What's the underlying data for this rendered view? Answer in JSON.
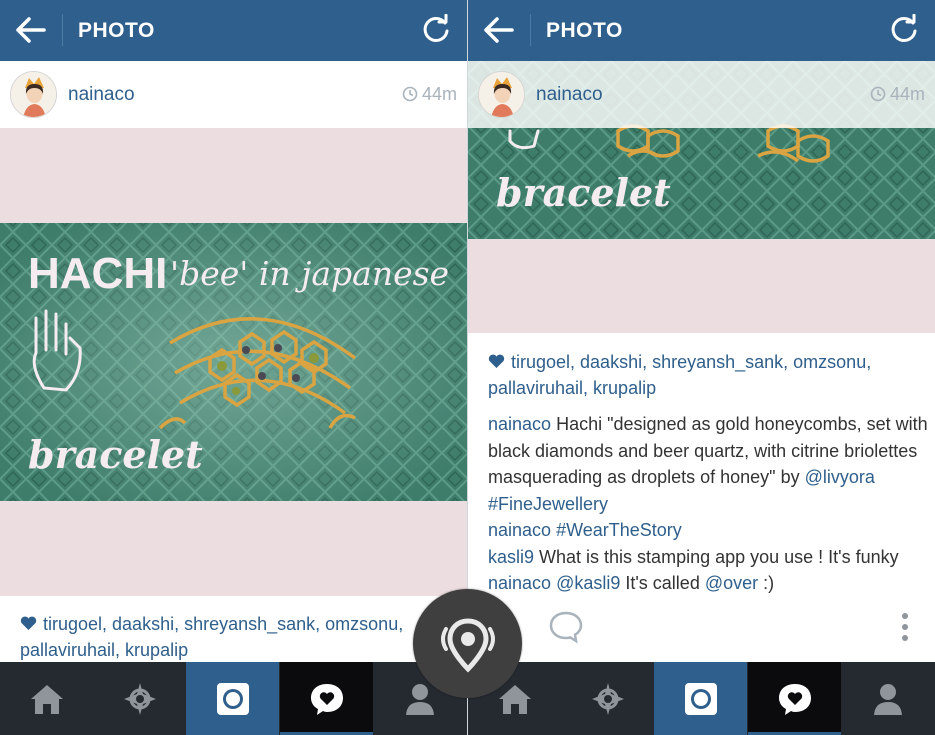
{
  "header": {
    "title": "PHOTO"
  },
  "post": {
    "username": "nainaco",
    "time_ago": "44m",
    "image_texts": {
      "line1": "HACHI",
      "line1_script": "'bee' in japanese",
      "line3": "bracelet"
    },
    "likes": "tirugoel, daakshi, shreyansh_sank, omzsonu, pallaviruhail, krupalip"
  },
  "comments": [
    {
      "user": "nainaco",
      "text": " Hachi \"designed as gold honeycombs, set with black diamonds and beer quartz, with citrine briolettes masquerading as droplets of honey\" by ",
      "mention": "@livyora",
      "tag": " #FineJewellery"
    },
    {
      "user": "nainaco",
      "tag": " #WearTheStory"
    },
    {
      "user": "kasli9",
      "text": " What is this stamping app you use ! It's funky"
    },
    {
      "user": "nainaco",
      "mention": " @kasli9",
      "text": " It's called ",
      "mention2": "@over",
      "text2": " :)"
    }
  ],
  "colors": {
    "header": "#2f5f8c",
    "tabbar": "#252a30",
    "link": "#2f5f8c",
    "active_tab": "#2f5f8c"
  },
  "tabs": [
    "home-icon",
    "explore-icon",
    "camera-icon",
    "activity-icon",
    "profile-icon"
  ]
}
